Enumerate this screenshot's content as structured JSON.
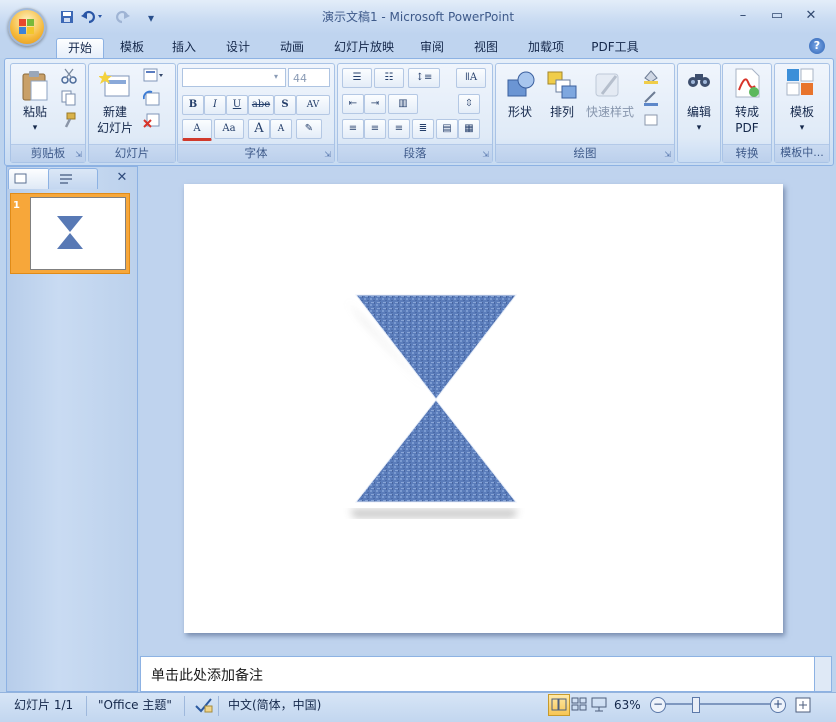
{
  "window": {
    "title": "演示文稿1 - Microsoft PowerPoint",
    "min_label": "–",
    "max_label": "▭",
    "close_label": "✕"
  },
  "qat": {
    "save_icon": "save-icon",
    "undo_icon": "undo-icon",
    "redo_icon": "redo-icon",
    "customize_label": "▾"
  },
  "tabs": [
    {
      "label": "开始"
    },
    {
      "label": "模板"
    },
    {
      "label": "插入"
    },
    {
      "label": "设计"
    },
    {
      "label": "动画"
    },
    {
      "label": "幻灯片放映"
    },
    {
      "label": "审阅"
    },
    {
      "label": "视图"
    },
    {
      "label": "加载项"
    },
    {
      "label": "PDF工具"
    }
  ],
  "help_label": "?",
  "ribbon": {
    "clipboard": {
      "paste_label": "粘贴",
      "group_label": "剪贴板"
    },
    "slides": {
      "new_slide_label_1": "新建",
      "new_slide_label_2": "幻灯片",
      "group_label": "幻灯片"
    },
    "font": {
      "font_name": "",
      "font_size": "44",
      "bold": "B",
      "italic": "I",
      "underline": "U",
      "strike": "abe",
      "shadow": "S",
      "spacing": "AV",
      "font_color": "A",
      "case": "Aa",
      "grow": "A",
      "shrink": "A",
      "group_label": "字体"
    },
    "paragraph": {
      "group_label": "段落"
    },
    "drawing": {
      "shapes_label": "形状",
      "arrange_label": "排列",
      "quick_styles_label": "快速样式",
      "group_label": "绘图"
    },
    "editing": {
      "label": "编辑"
    },
    "convert": {
      "label_1": "转成",
      "label_2": "PDF",
      "group_label": "转换"
    },
    "templates": {
      "label": "模板",
      "group_label": "模板中..."
    }
  },
  "left_pane": {
    "close_label": "✕",
    "slide_number": "1"
  },
  "notes": {
    "placeholder": "单击此处添加备注"
  },
  "status": {
    "slide_info": "幻灯片 1/1",
    "theme": "\"Office 主题\"",
    "language": "中文(简体，中国)",
    "zoom": "63%"
  },
  "colors": {
    "accent": "#4f74b8",
    "shape_fill": "#5879b5",
    "highlight": "#f7a73a"
  }
}
